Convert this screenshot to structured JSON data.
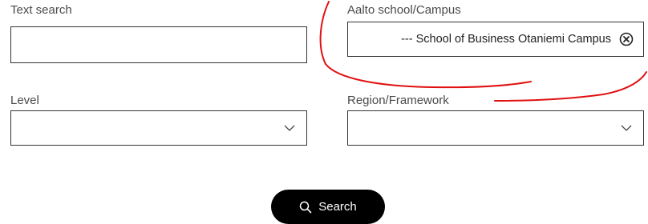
{
  "form": {
    "text_search": {
      "label": "Text search",
      "value": ""
    },
    "campus": {
      "label": "Aalto school/Campus",
      "selected": "--- School of Business Otaniemi Campus"
    },
    "level": {
      "label": "Level",
      "value": ""
    },
    "region": {
      "label": "Region/Framework",
      "value": ""
    },
    "search_button": {
      "label": "Search"
    }
  },
  "icons": {
    "clear": "clear-circle-x-icon",
    "dropdown": "chevron-down-icon",
    "search": "magnifier-icon"
  },
  "colors": {
    "button_background": "#000000",
    "button_text": "#ffffff",
    "annotation_stroke": "#e01010",
    "field_border": "#333333"
  }
}
